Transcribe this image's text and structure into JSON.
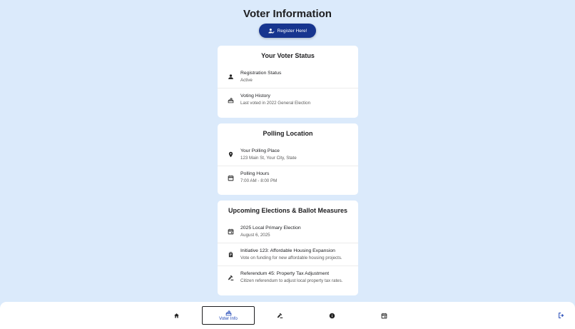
{
  "header": {
    "title": "Voter Information",
    "register_label": "Register Here!"
  },
  "voter_status": {
    "title": "Your Voter Status",
    "items": [
      {
        "icon": "person-icon",
        "primary": "Registration Status",
        "secondary": "Active"
      },
      {
        "icon": "ballot-box-icon",
        "primary": "Voting History",
        "secondary": "Last voted in 2022 General Election"
      }
    ]
  },
  "polling": {
    "title": "Polling Location",
    "items": [
      {
        "icon": "location-pin-icon",
        "primary": "Your Polling Place",
        "secondary": "123 Main St, Your City, State"
      },
      {
        "icon": "calendar-icon",
        "primary": "Polling Hours",
        "secondary": "7:00 AM - 8:00 PM"
      }
    ]
  },
  "elections": {
    "title": "Upcoming Elections & Ballot Measures",
    "items": [
      {
        "icon": "event-icon",
        "primary": "2025 Local Primary Election",
        "secondary": "August 6, 2025"
      },
      {
        "icon": "clipboard-icon",
        "primary": "Initiative 123: Affordable Housing Expansion",
        "secondary": "Vote on funding for new affordable housing projects."
      },
      {
        "icon": "gavel-icon",
        "primary": "Referendum 45: Property Tax Adjustment",
        "secondary": "Citizen referendum to adjust local property tax rates."
      }
    ]
  },
  "nav": {
    "items": [
      {
        "icon": "home-icon",
        "label": ""
      },
      {
        "icon": "ballot-box-icon",
        "label": "Voter Info",
        "active": true
      },
      {
        "icon": "gavel-icon",
        "label": ""
      },
      {
        "icon": "info-icon",
        "label": ""
      },
      {
        "icon": "event-icon",
        "label": ""
      }
    ],
    "logout_icon": "logout-icon"
  },
  "colors": {
    "background": "#dbeafb",
    "primary_button": "#17358f",
    "active_nav_label": "#1f46b5",
    "card": "#ffffff"
  }
}
